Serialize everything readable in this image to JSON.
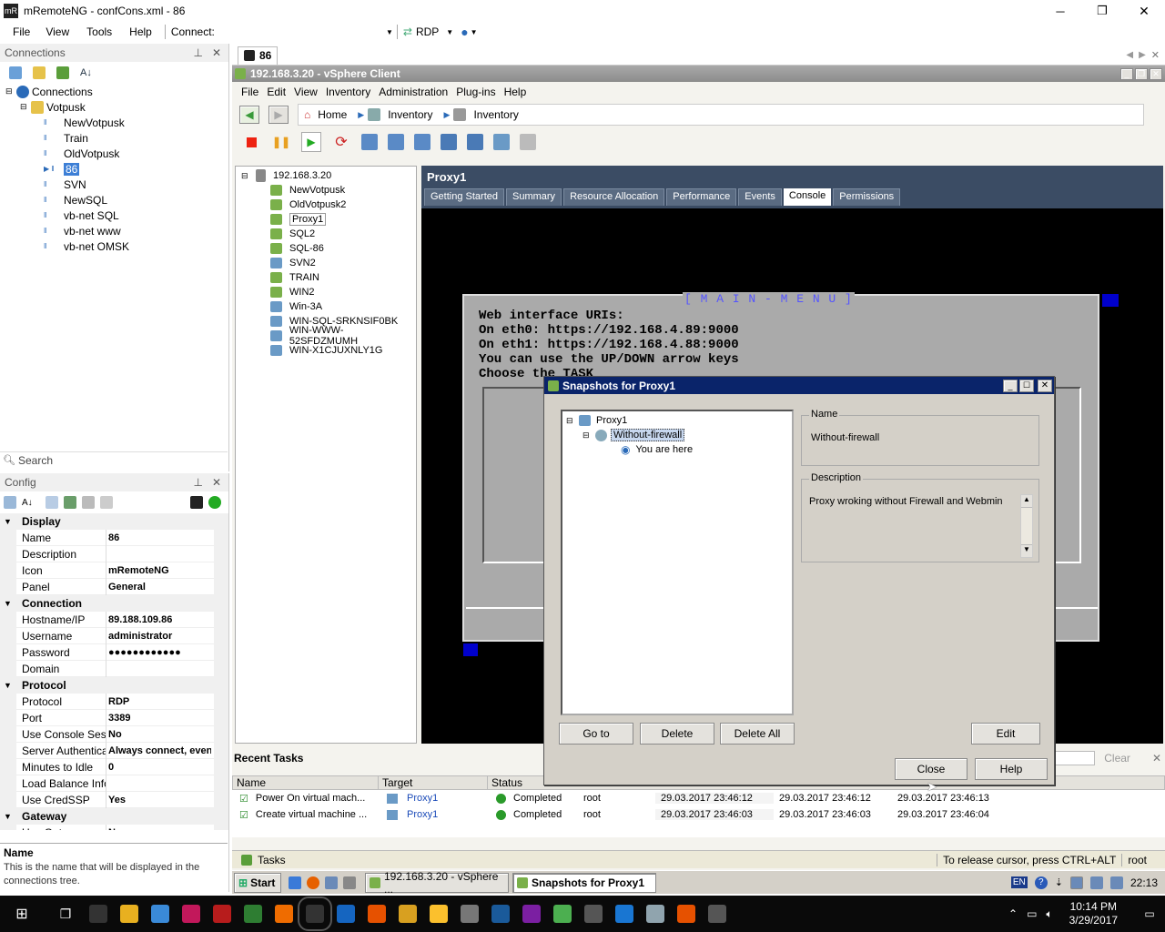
{
  "window": {
    "title": "mRemoteNG - confCons.xml - 86",
    "controls": [
      "─",
      "❐",
      "✕"
    ]
  },
  "menubar": {
    "items": [
      "File",
      "View",
      "Tools",
      "Help"
    ],
    "connect_label": "Connect:",
    "protocol": "RDP"
  },
  "connections": {
    "title": "Connections",
    "pin": "⊥",
    "close": "✕",
    "root": "Connections",
    "folder": "Votpusk",
    "items": [
      "NewVotpusk",
      "Train",
      "OldVotpusk",
      "86",
      "SVN",
      "NewSQL",
      "vb-net SQL",
      "vb-net www",
      "vb-net OMSK"
    ],
    "search_placeholder": "Search"
  },
  "config": {
    "title": "Config",
    "sections": [
      {
        "name": "Display",
        "rows": [
          [
            "Name",
            "86"
          ],
          [
            "Description",
            ""
          ],
          [
            "Icon",
            "mRemoteNG"
          ],
          [
            "Panel",
            "General"
          ]
        ]
      },
      {
        "name": "Connection",
        "rows": [
          [
            "Hostname/IP",
            "89.188.109.86"
          ],
          [
            "Username",
            "administrator"
          ],
          [
            "Password",
            "●●●●●●●●●●●●"
          ],
          [
            "Domain",
            ""
          ]
        ]
      },
      {
        "name": "Protocol",
        "rows": [
          [
            "Protocol",
            "RDP"
          ],
          [
            "Port",
            "3389"
          ],
          [
            "Use Console Sessi",
            "No"
          ],
          [
            "Server Authentica",
            "Always connect, even"
          ],
          [
            "Minutes to Idle",
            "0"
          ],
          [
            "Load Balance Info",
            ""
          ],
          [
            "Use CredSSP",
            "Yes"
          ]
        ]
      },
      {
        "name": "Gateway",
        "rows": [
          [
            "Use Gateway",
            "Never"
          ]
        ]
      }
    ],
    "help_title": "Name",
    "help_text": "This is the name that will be displayed in the connections tree."
  },
  "session_tab": {
    "label": "86"
  },
  "vsphere": {
    "title": "192.168.3.20 - vSphere Client",
    "menu": [
      "File",
      "Edit",
      "View",
      "Inventory",
      "Administration",
      "Plug-ins",
      "Help"
    ],
    "breadcrumb": [
      "Home",
      "Inventory",
      "Inventory"
    ],
    "tree_root": "192.168.3.20",
    "vms": [
      "NewVotpusk",
      "OldVotpusk2",
      "Proxy1",
      "SQL2",
      "SQL-86",
      "SVN2",
      "TRAIN",
      "WIN2",
      "Win-3A",
      "WIN-SQL-SRKNSIF0BK",
      "WIN-WWW-52SFDZMUMH",
      "WIN-X1CJUXNLY1G"
    ],
    "selected_vm": "Proxy1",
    "tabs": [
      "Getting Started",
      "Summary",
      "Resource Allocation",
      "Performance",
      "Events",
      "Console",
      "Permissions"
    ],
    "active_tab": "Console",
    "console": {
      "menu_title": "[ M A I N - M E N U ]",
      "lines": [
        "Web interface URIs:",
        "On eth0: https://192.168.4.89:9000",
        "On eth1: https://192.168.4.88:9000",
        "You can use the UP/DOWN arrow keys",
        "Choose the TASK"
      ]
    },
    "recent_tasks": {
      "title": "Recent Tasks",
      "clear": "Clear",
      "headers": [
        "Name",
        "Target",
        "Status"
      ],
      "rows": [
        [
          "Power On virtual mach...",
          "Proxy1",
          "Completed",
          "root",
          "29.03.2017 23:46:12",
          "29.03.2017 23:46:12",
          "29.03.2017 23:46:13"
        ],
        [
          "Create virtual machine ...",
          "Proxy1",
          "Completed",
          "root",
          "29.03.2017 23:46:03",
          "29.03.2017 23:46:03",
          "29.03.2017 23:46:04"
        ]
      ]
    },
    "status": {
      "tasks": "Tasks",
      "release": "To release cursor, press CTRL+ALT",
      "user": "root"
    }
  },
  "snapshots": {
    "title": "Snapshots for Proxy1",
    "tree": {
      "root": "Proxy1",
      "snapshot": "Without-firewall",
      "current": "You are here"
    },
    "name_label": "Name",
    "name_value": "Without-firewall",
    "desc_label": "Description",
    "desc_value": "Proxy wroking without Firewall and Webmin",
    "buttons": {
      "goto": "Go to",
      "delete": "Delete",
      "delete_all": "Delete All",
      "edit": "Edit",
      "close": "Close",
      "help": "Help"
    }
  },
  "inner_taskbar": {
    "start": "Start",
    "items": [
      "192.168.3.20 - vSphere ...",
      "Snapshots for Proxy1"
    ],
    "lang": "EN",
    "time": "22:13"
  },
  "taskbar": {
    "time": "10:14 PM",
    "date": "3/29/2017"
  }
}
